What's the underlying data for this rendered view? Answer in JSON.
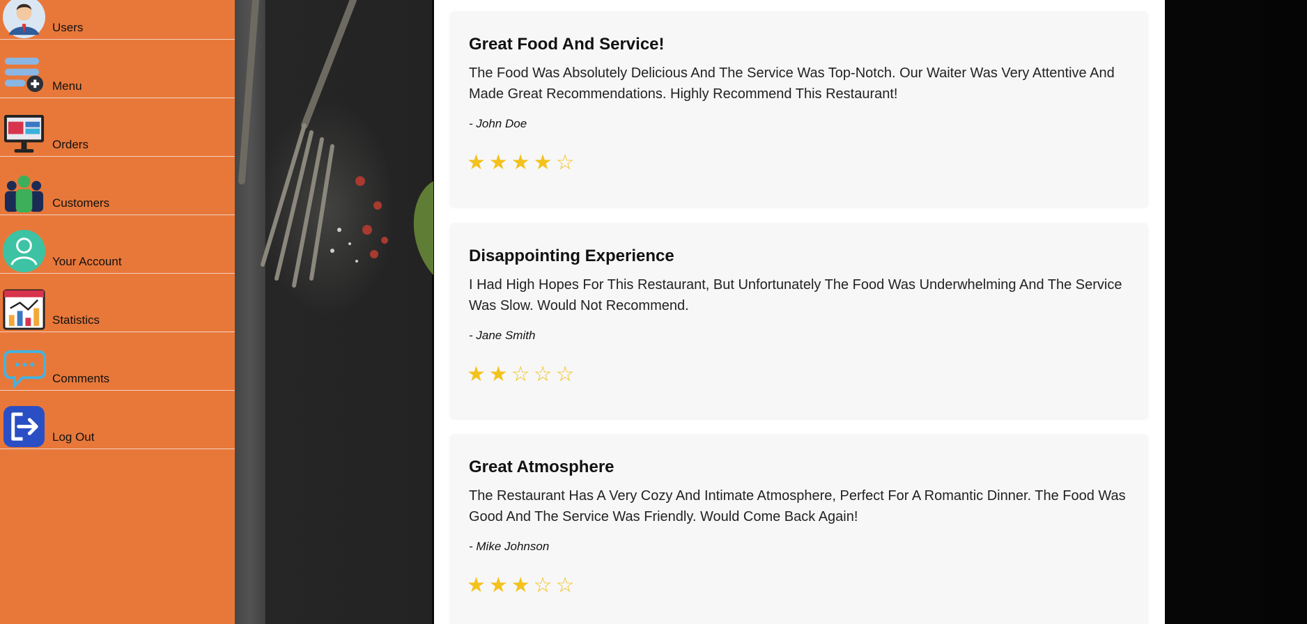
{
  "sidebar": {
    "items": [
      {
        "label": "Users",
        "icon": "user-avatar-icon"
      },
      {
        "label": "Menu",
        "icon": "menu-list-icon"
      },
      {
        "label": "Orders",
        "icon": "monitor-dashboard-icon"
      },
      {
        "label": "Customers",
        "icon": "group-people-icon"
      },
      {
        "label": "Your Account",
        "icon": "account-person-icon"
      },
      {
        "label": "Statistics",
        "icon": "statistics-chart-icon"
      },
      {
        "label": "Comments",
        "icon": "chat-bubble-icon"
      },
      {
        "label": "Log Out",
        "icon": "logout-icon"
      }
    ],
    "accent": "#e8783a"
  },
  "reviews": [
    {
      "title": "Great Food And Service!",
      "text": "The Food Was Absolutely Delicious And The Service Was Top-Notch. Our Waiter Was Very Attentive And Made Great Recommendations. Highly Recommend This Restaurant!",
      "author": "- John Doe",
      "rating": 4,
      "stars": "★★★★☆"
    },
    {
      "title": "Disappointing Experience",
      "text": "I Had High Hopes For This Restaurant, But Unfortunately The Food Was Underwhelming And The Service Was Slow. Would Not Recommend.",
      "author": "- Jane Smith",
      "rating": 2,
      "stars": "★★☆☆☆"
    },
    {
      "title": "Great Atmosphere",
      "text": "The Restaurant Has A Very Cozy And Intimate Atmosphere, Perfect For A Romantic Dinner. The Food Was Good And The Service Was Friendly. Would Come Back Again!",
      "author": "- Mike Johnson",
      "rating": 3,
      "stars": "★★★☆☆"
    }
  ],
  "colors": {
    "star": "#f3c21c",
    "card": "#f7f7f7"
  }
}
